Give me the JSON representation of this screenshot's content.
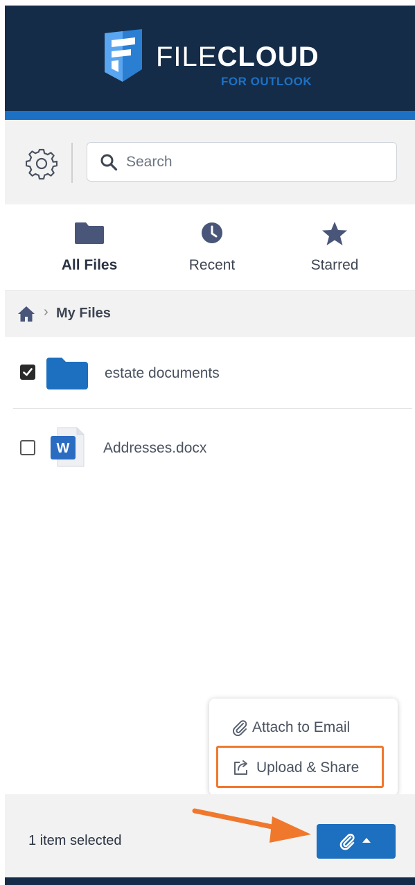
{
  "header": {
    "brand_light": "FILE",
    "brand_bold": "CLOUD",
    "brand_sub": "FOR OUTLOOK",
    "logo_icon": "filecloud-logo-icon",
    "colors": {
      "header_bg": "#142c48",
      "accent": "#1d71c4"
    }
  },
  "toolbar": {
    "settings_icon": "gear-icon",
    "search": {
      "placeholder": "Search",
      "value": ""
    }
  },
  "tabs": [
    {
      "label": "All Files",
      "icon": "folder-icon",
      "active": true
    },
    {
      "label": "Recent",
      "icon": "clock-icon",
      "active": false
    },
    {
      "label": "Starred",
      "icon": "star-icon",
      "active": false
    }
  ],
  "breadcrumb": {
    "home_icon": "home-icon",
    "separator": "›",
    "current": "My Files"
  },
  "files": [
    {
      "name": "estate documents",
      "type": "folder",
      "checked": true
    },
    {
      "name": "Addresses.docx",
      "type": "word-document",
      "checked": false
    }
  ],
  "menu": {
    "items": [
      {
        "label": "Attach to Email",
        "icon": "paperclip-icon"
      },
      {
        "label": "Upload & Share",
        "icon": "share-icon",
        "highlighted": true
      }
    ]
  },
  "footer": {
    "status": "1 item selected",
    "action_icon": "paperclip-icon"
  }
}
